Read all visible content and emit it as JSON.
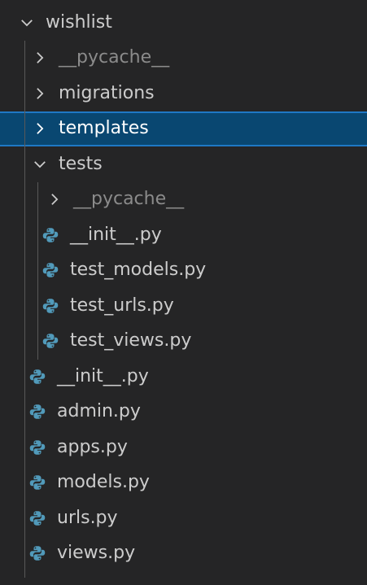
{
  "explorer": {
    "root": {
      "label": "wishlist",
      "icon": "chevron-down-icon",
      "expanded": true
    },
    "items": [
      {
        "label": "__pycache__",
        "type": "folder",
        "expanded": false,
        "dim": true,
        "depth": 1
      },
      {
        "label": "migrations",
        "type": "folder",
        "expanded": false,
        "dim": false,
        "depth": 1
      },
      {
        "label": "templates",
        "type": "folder",
        "expanded": false,
        "dim": false,
        "depth": 1,
        "selected": true
      },
      {
        "label": "tests",
        "type": "folder",
        "expanded": true,
        "dim": false,
        "depth": 1
      },
      {
        "label": "__pycache__",
        "type": "folder",
        "expanded": false,
        "dim": true,
        "depth": 2
      },
      {
        "label": "__init__.py",
        "type": "python-file",
        "depth": 2
      },
      {
        "label": "test_models.py",
        "type": "python-file",
        "depth": 2
      },
      {
        "label": "test_urls.py",
        "type": "python-file",
        "depth": 2
      },
      {
        "label": "test_views.py",
        "type": "python-file",
        "depth": 2
      },
      {
        "label": "__init__.py",
        "type": "python-file",
        "depth": 1
      },
      {
        "label": "admin.py",
        "type": "python-file",
        "depth": 1
      },
      {
        "label": "apps.py",
        "type": "python-file",
        "depth": 1
      },
      {
        "label": "models.py",
        "type": "python-file",
        "depth": 1
      },
      {
        "label": "urls.py",
        "type": "python-file",
        "depth": 1
      },
      {
        "label": "views.py",
        "type": "python-file",
        "depth": 1
      }
    ]
  },
  "colors": {
    "background": "#252526",
    "text": "#cccccc",
    "dim_text": "#8b8b8b",
    "selection_bg": "#094771",
    "selection_border": "#1f78c4",
    "python_icon": "#519aba"
  }
}
